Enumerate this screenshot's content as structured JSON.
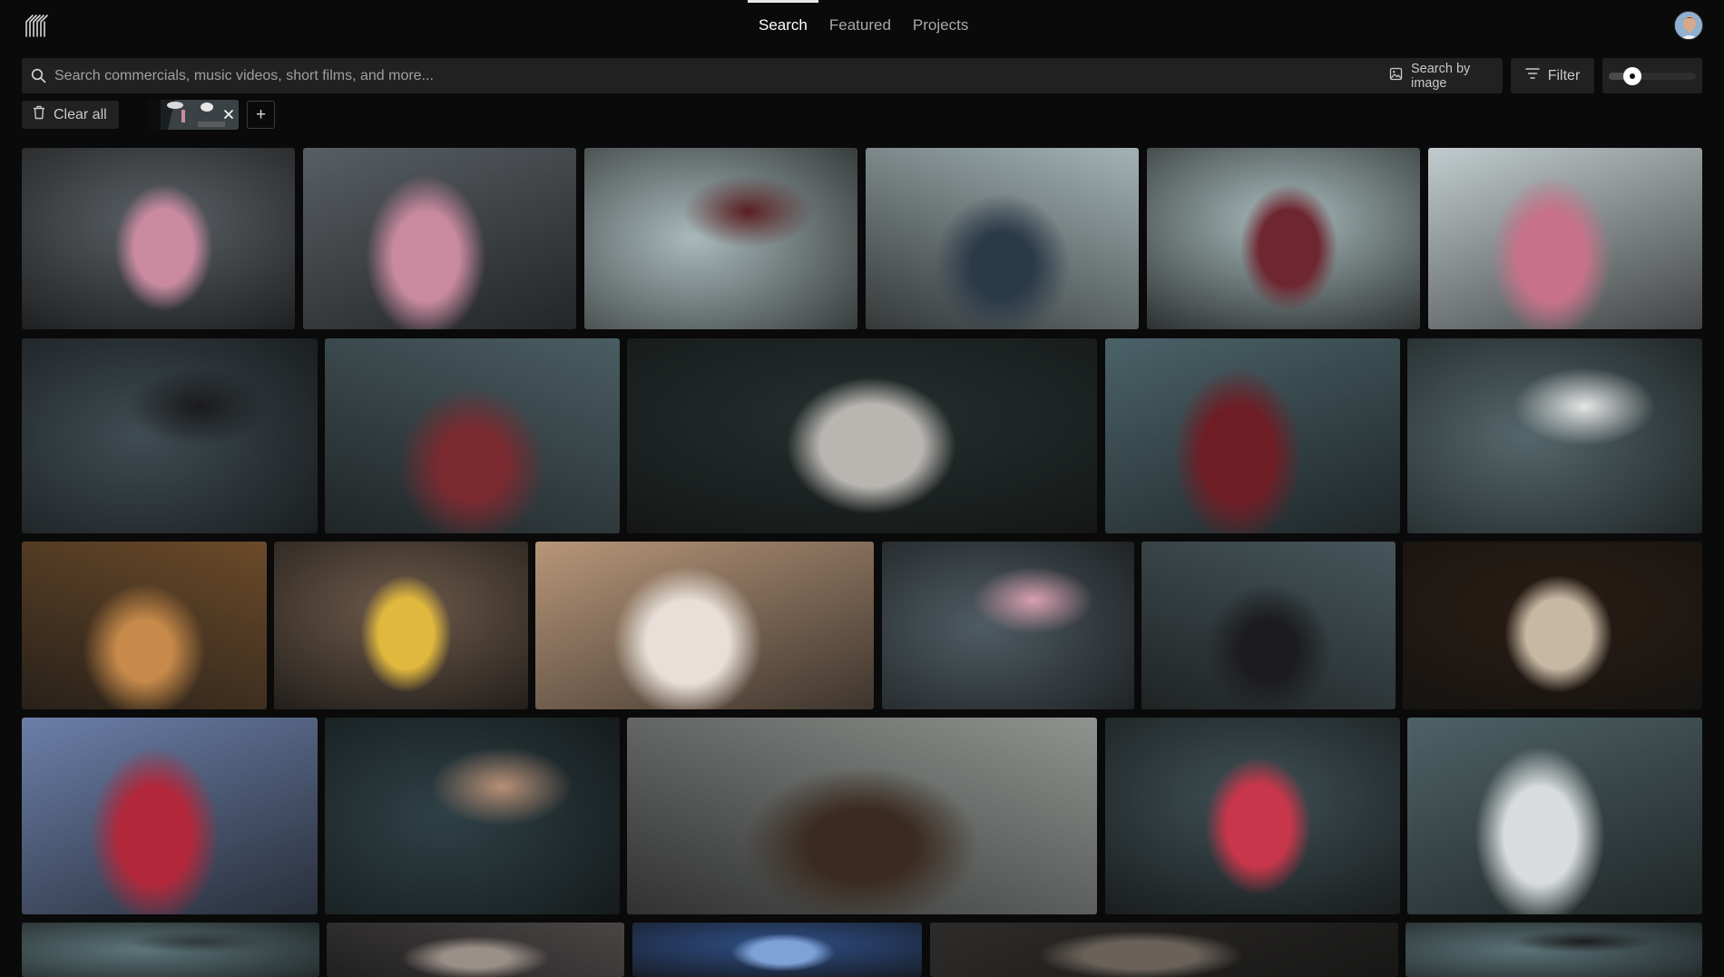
{
  "header": {
    "tabs": [
      {
        "label": "Search",
        "active": true
      },
      {
        "label": "Featured",
        "active": false
      },
      {
        "label": "Projects",
        "active": false
      }
    ],
    "logo_icon": "striped-logo-icon",
    "avatar_icon": "user-avatar"
  },
  "search": {
    "placeholder": "Search commercials, music videos, short films, and more...",
    "value": "",
    "search_by_image_label": "Search by image"
  },
  "toolbar": {
    "filter_label": "Filter",
    "tile_size_fraction": 0.27,
    "clear_all_label": "Clear all",
    "add_label": "+"
  },
  "colors": {
    "background": "#0a0a0a",
    "control_bg": "#212121",
    "active_text": "#ffffff",
    "muted_text": "#a8a8a8"
  },
  "results": {
    "thumbnails": [
      {
        "scene": "studio-softbox-woman-pink",
        "bg": "#5b6166",
        "accent": "#c98aa0"
      },
      {
        "scene": "studio-softbox-woman-pink-2",
        "bg": "#585e63",
        "accent": "#c98aa0"
      },
      {
        "scene": "studio-crouch-white-room",
        "bg": "#a9b9bb",
        "accent": "#5a1f22"
      },
      {
        "scene": "studio-standing-jeans",
        "bg": "#a3b3b5",
        "accent": "#2b3a48"
      },
      {
        "scene": "vacuum-on-rug-overhead",
        "bg": "#a9bcbd",
        "accent": "#6e2630"
      },
      {
        "scene": "woman-pink-sweater-floor",
        "bg": "#c2ccce",
        "accent": "#c7728a"
      },
      {
        "scene": "woman-black-top-necklace",
        "bg": "#3f4c52",
        "accent": "#1a1a1c"
      },
      {
        "scene": "vacuum-close-rug",
        "bg": "#4a5d63",
        "accent": "#7b2a30"
      },
      {
        "scene": "dark-floor-walking-legs",
        "bg": "#25302f",
        "accent": "#b9b6b2"
      },
      {
        "scene": "sunglasses-red-jacket",
        "bg": "#4a6268",
        "accent": "#6f1d25"
      },
      {
        "scene": "woman-bed-reading",
        "bg": "#55676b",
        "accent": "#e6e6e6"
      },
      {
        "scene": "silhouette-amber-veil",
        "bg": "#6b4a2a",
        "accent": "#c78a4a"
      },
      {
        "scene": "table-candles-magazines",
        "bg": "#6e5a4a",
        "accent": "#e0b83e"
      },
      {
        "scene": "face-under-water-foam",
        "bg": "#b7967a",
        "accent": "#e8e0d8"
      },
      {
        "scene": "sunglasses-pink-blouse",
        "bg": "#4f5c63",
        "accent": "#d9a0b0"
      },
      {
        "scene": "hands-on-table-necklace",
        "bg": "#46565b",
        "accent": "#1c1c1e"
      },
      {
        "scene": "round-mirror-dark",
        "bg": "#2a1d14",
        "accent": "#c7b8a3"
      },
      {
        "scene": "red-buildings-sky",
        "bg": "#6b7fa8",
        "accent": "#b3273a"
      },
      {
        "scene": "woman-eyes-closed",
        "bg": "#2f4146",
        "accent": "#b89077"
      },
      {
        "scene": "messy-apartment-wine",
        "bg": "#8f9490",
        "accent": "#3a2a20"
      },
      {
        "scene": "red-lipstick-closeup",
        "bg": "#3f5055",
        "accent": "#c7364a"
      },
      {
        "scene": "woman-pillow-smile",
        "bg": "#4e6266",
        "accent": "#d8dcdc"
      },
      {
        "scene": "teal-feet-partial",
        "bg": "#5c7579",
        "accent": "#30383a"
      },
      {
        "scene": "blurred-hair-dark",
        "bg": "#4a4646",
        "accent": "#9a8f88"
      },
      {
        "scene": "blue-sky-gradient",
        "bg": "#2f4f86",
        "accent": "#7ea1d6"
      },
      {
        "scene": "crowd-audience",
        "bg": "#2e2c2a",
        "accent": "#6a625a"
      },
      {
        "scene": "sunglasses-teal-partial",
        "bg": "#5a7276",
        "accent": "#1c1c1c"
      }
    ]
  }
}
